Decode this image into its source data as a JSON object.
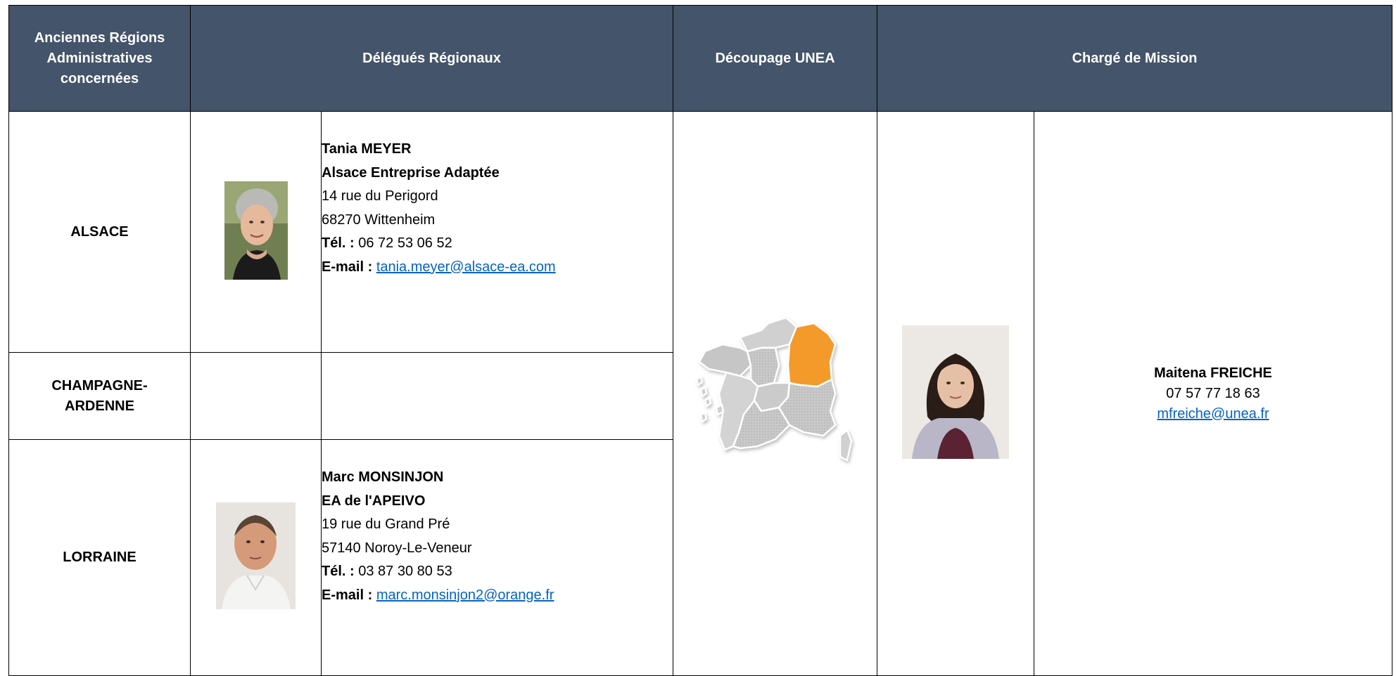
{
  "headers": {
    "regions": "Anciennes Régions Administratives concernées",
    "delegates": "Délégués Régionaux",
    "split": "Découpage UNEA",
    "mission": "Chargé de Mission"
  },
  "rows": [
    {
      "region": "ALSACE",
      "name": "Tania MEYER",
      "org": "Alsace Entreprise Adaptée",
      "address1": "14 rue du Perigord",
      "address2": "68270 Wittenheim",
      "tel_label": "Tél. :",
      "tel": " 06 72 53 06 52",
      "email_label": "E-mail :",
      "email": "tania.meyer@alsace-ea.com"
    },
    {
      "region": "CHAMPAGNE-ARDENNE"
    },
    {
      "region": "LORRAINE",
      "name": "Marc MONSINJON",
      "org": "EA de l'APEIVO",
      "address1": "19 rue du Grand Pré",
      "address2": "57140 Noroy-Le-Veneur",
      "tel_label": "Tél. :",
      "tel": "03 87 30 80 53",
      "email_label": "E-mail :",
      "email": "marc.monsinjon2@orange.fr"
    }
  ],
  "mission": {
    "name": "Maitena FREICHE",
    "phone": "07 57 77 18 63",
    "email": "mfreiche@unea.fr"
  },
  "colors": {
    "header_bg": "#44546a",
    "highlight_region": "#f39a2b",
    "link": "#0563c1"
  }
}
